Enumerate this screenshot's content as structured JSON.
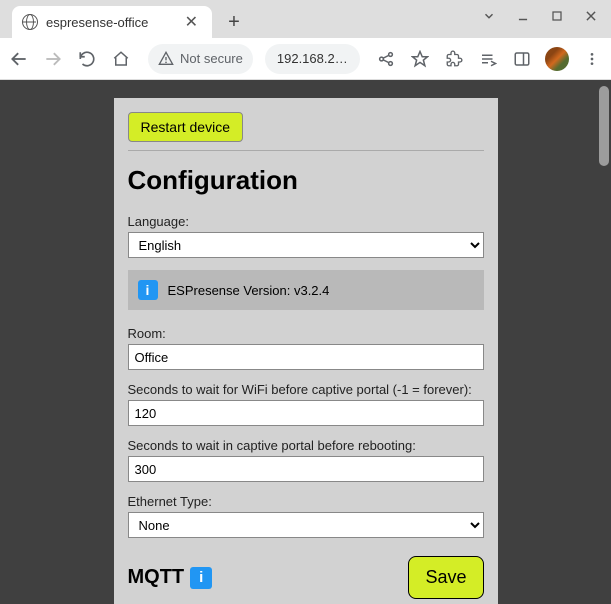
{
  "browser": {
    "tab_title": "espresense-office",
    "not_secure_label": "Not secure",
    "url_display": "192.168.2…"
  },
  "page": {
    "restart_label": "Restart device",
    "heading": "Configuration",
    "language": {
      "label": "Language:",
      "value": "English"
    },
    "version_text": "ESPresense Version: v3.2.4",
    "room": {
      "label": "Room:",
      "value": "Office"
    },
    "wifi_timeout": {
      "label": "Seconds to wait for WiFi before captive portal (-1 = forever):",
      "value": "120"
    },
    "portal_timeout": {
      "label": "Seconds to wait in captive portal before rebooting:",
      "value": "300"
    },
    "ethernet": {
      "label": "Ethernet Type:",
      "value": "None"
    },
    "mqtt_heading": "MQTT",
    "save_label": "Save"
  }
}
